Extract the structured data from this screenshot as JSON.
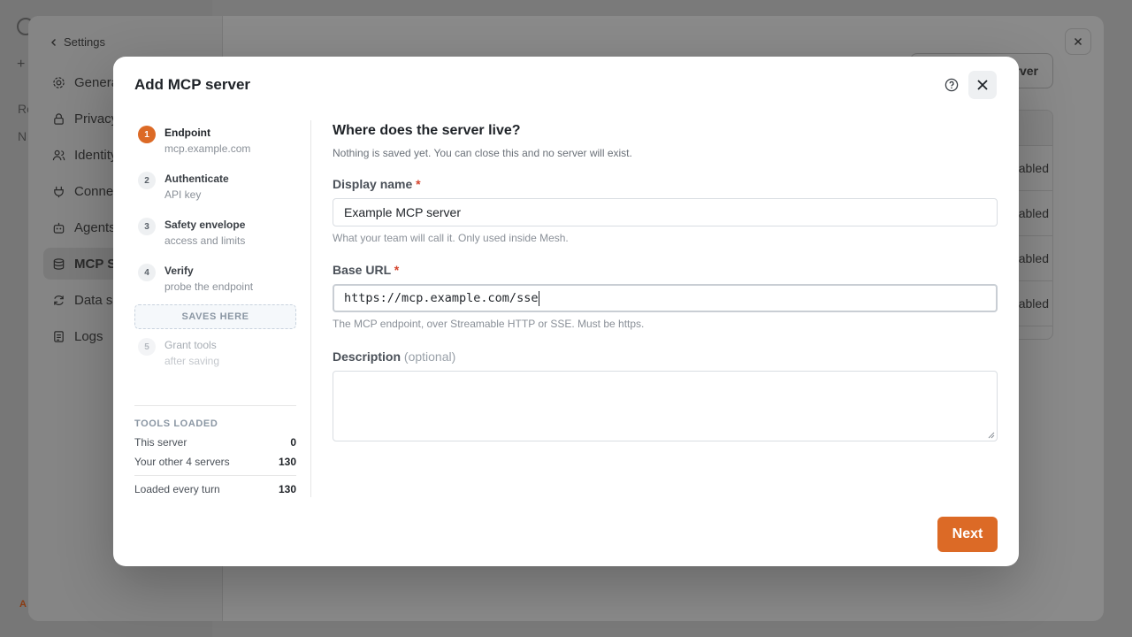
{
  "background": {
    "rail_text_1": "Re",
    "rail_text_2": "N",
    "rail_bottom": "A",
    "settings_back": "Settings",
    "nav_items": [
      {
        "label": "General",
        "icon": "gear-icon"
      },
      {
        "label": "Privacy",
        "icon": "lock-icon"
      },
      {
        "label": "Identity",
        "icon": "users-icon"
      },
      {
        "label": "Connections",
        "icon": "plug-icon"
      },
      {
        "label": "Agents",
        "icon": "robot-icon"
      },
      {
        "label": "MCP Servers",
        "icon": "database-icon"
      },
      {
        "label": "Data sources",
        "icon": "refresh-icon"
      },
      {
        "label": "Logs",
        "icon": "log-icon"
      }
    ],
    "add_button_label": "rver",
    "row_status": [
      "abled",
      "abled",
      "abled",
      "abled"
    ]
  },
  "modal": {
    "title": "Add MCP server",
    "steps": [
      {
        "num": "1",
        "title": "Endpoint",
        "sub": "mcp.example.com",
        "state": "active"
      },
      {
        "num": "2",
        "title": "Authenticate",
        "sub": "API key",
        "state": "pending"
      },
      {
        "num": "3",
        "title": "Safety envelope",
        "sub": "access and limits",
        "state": "pending"
      },
      {
        "num": "4",
        "title": "Verify",
        "sub": "probe the endpoint",
        "state": "pending"
      },
      {
        "num": "5",
        "title": "Grant tools",
        "sub": "after saving",
        "state": "disabled"
      }
    ],
    "saves_here": "SAVES HERE",
    "tools": {
      "heading": "TOOLS LOADED",
      "rows": [
        {
          "label": "This server",
          "value": "0"
        },
        {
          "label": "Your other 4 servers",
          "value": "130"
        }
      ],
      "total": {
        "label": "Loaded every turn",
        "value": "130"
      }
    },
    "form": {
      "heading": "Where does the server live?",
      "sub": "Nothing is saved yet. You can close this and no server will exist.",
      "display_name": {
        "label": "Display name",
        "required_mark": "*",
        "value": "Example MCP server",
        "hint": "What your team will call it. Only used inside Mesh."
      },
      "base_url": {
        "label": "Base URL",
        "required_mark": "*",
        "value": "https://mcp.example.com/sse",
        "hint": "The MCP endpoint, over Streamable HTTP or SSE. Must be https."
      },
      "description": {
        "label": "Description",
        "optional": "(optional)",
        "value": ""
      }
    },
    "next_label": "Next"
  },
  "colors": {
    "accent": "#dc6a26",
    "required": "#d4432c"
  }
}
